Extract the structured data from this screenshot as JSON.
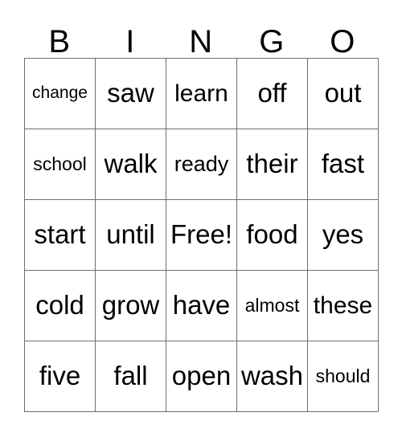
{
  "card": {
    "headers": [
      "B",
      "I",
      "N",
      "G",
      "O"
    ],
    "rows": [
      [
        {
          "text": "change",
          "size": "fs-xs"
        },
        {
          "text": "saw",
          "size": "fs-xl"
        },
        {
          "text": "learn",
          "size": "fs-lg"
        },
        {
          "text": "off",
          "size": "fs-xl"
        },
        {
          "text": "out",
          "size": "fs-xl"
        }
      ],
      [
        {
          "text": "school",
          "size": "fs-sm"
        },
        {
          "text": "walk",
          "size": "fs-xl"
        },
        {
          "text": "ready",
          "size": "fs-md"
        },
        {
          "text": "their",
          "size": "fs-xl"
        },
        {
          "text": "fast",
          "size": "fs-xl"
        }
      ],
      [
        {
          "text": "start",
          "size": "fs-xl"
        },
        {
          "text": "until",
          "size": "fs-xl"
        },
        {
          "text": "Free!",
          "size": "fs-xl"
        },
        {
          "text": "food",
          "size": "fs-xl"
        },
        {
          "text": "yes",
          "size": "fs-xl"
        }
      ],
      [
        {
          "text": "cold",
          "size": "fs-xl"
        },
        {
          "text": "grow",
          "size": "fs-xl"
        },
        {
          "text": "have",
          "size": "fs-xl"
        },
        {
          "text": "almost",
          "size": "fs-sm"
        },
        {
          "text": "these",
          "size": "fs-lg"
        }
      ],
      [
        {
          "text": "five",
          "size": "fs-xl"
        },
        {
          "text": "fall",
          "size": "fs-xl"
        },
        {
          "text": "open",
          "size": "fs-xl"
        },
        {
          "text": "wash",
          "size": "fs-xl"
        },
        {
          "text": "should",
          "size": "fs-sm"
        }
      ]
    ],
    "free_space": "Free!",
    "colors": {
      "background": "#ffffff",
      "text": "#000000",
      "border": "#6e6e6e"
    }
  }
}
